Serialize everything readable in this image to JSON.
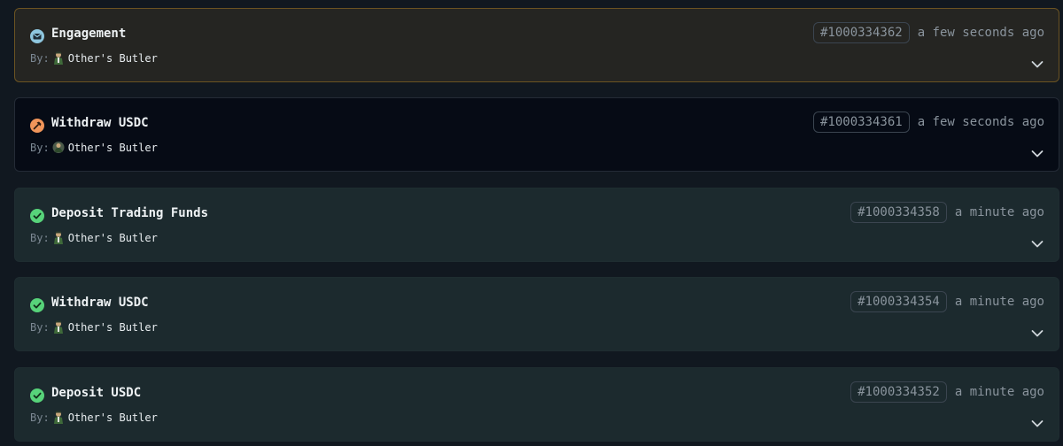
{
  "transactions": [
    {
      "title": "Engagement",
      "status": "engagement",
      "status_icon": "envelope-icon",
      "status_color": "#8fc7df",
      "by_label": "By:",
      "author": "Other's Butler",
      "avatar_icon": "butler-avatar-icon",
      "id": "#1000334362",
      "time": "a few seconds ago"
    },
    {
      "title": "Withdraw USDC",
      "status": "pending",
      "status_icon": "hammer-icon",
      "status_color": "#f0955a",
      "by_label": "By:",
      "author": "Other's Butler",
      "avatar_icon": "butler-avatar-icon",
      "id": "#1000334361",
      "time": "a few seconds ago"
    },
    {
      "title": "Deposit Trading Funds",
      "status": "success",
      "status_icon": "check-circle-icon",
      "status_color": "#57d37a",
      "by_label": "By:",
      "author": "Other's Butler",
      "avatar_icon": "butler-avatar-icon",
      "id": "#1000334358",
      "time": "a minute ago"
    },
    {
      "title": "Withdraw USDC",
      "status": "success",
      "status_icon": "check-circle-icon",
      "status_color": "#57d37a",
      "by_label": "By:",
      "author": "Other's Butler",
      "avatar_icon": "butler-avatar-icon",
      "id": "#1000334354",
      "time": "a minute ago"
    },
    {
      "title": "Deposit USDC",
      "status": "success",
      "status_icon": "check-circle-icon",
      "status_color": "#57d37a",
      "by_label": "By:",
      "author": "Other's Butler",
      "avatar_icon": "butler-avatar-icon",
      "id": "#1000334352",
      "time": "a minute ago"
    }
  ]
}
